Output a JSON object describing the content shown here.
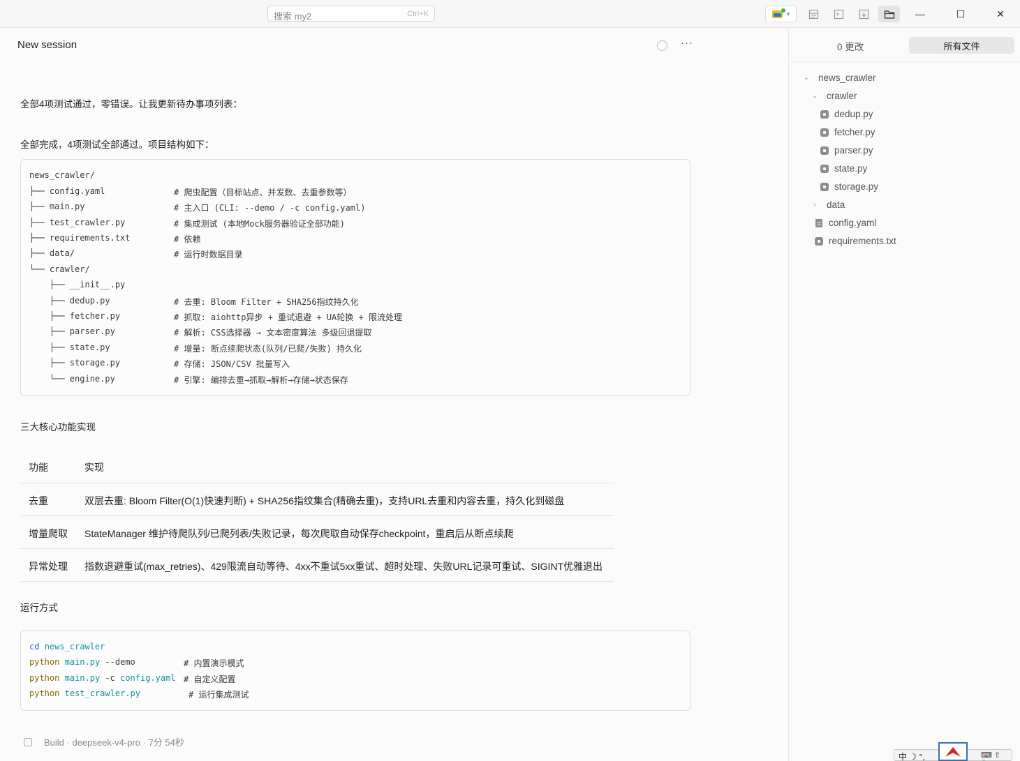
{
  "titlebar": {
    "search_placeholder": "搜索 my2",
    "search_shortcut": "Ctrl+K",
    "folder_dropdown": "▾",
    "icons": [
      "folder-icon",
      "layout-icon",
      "terminal-icon",
      "download-icon",
      "file-tree-icon"
    ],
    "window_controls": {
      "minimize": "—",
      "maximize": "☐",
      "close": "✕"
    }
  },
  "session": {
    "title": "New session",
    "more": "···"
  },
  "messages": {
    "m1": "全部4项测试通过，零错误。让我更新待办事项列表：",
    "m2": "全部完成，4项测试全部通过。项目结构如下：",
    "m3": "三大核心功能实现",
    "m4": "运行方式"
  },
  "tree_block": [
    {
      "path": "news_crawler/",
      "comment": ""
    },
    {
      "path": "├── config.yaml",
      "comment": "# 爬虫配置（目标站点、并发数、去重参数等）"
    },
    {
      "path": "├── main.py",
      "comment": "# 主入口 (CLI: --demo / -c config.yaml)"
    },
    {
      "path": "├── test_crawler.py",
      "comment": "# 集成测试 (本地Mock服务器验证全部功能)"
    },
    {
      "path": "├── requirements.txt",
      "comment": "# 依赖"
    },
    {
      "path": "├── data/",
      "comment": "# 运行时数据目录"
    },
    {
      "path": "└── crawler/",
      "comment": ""
    },
    {
      "path": "    ├── __init__.py",
      "comment": ""
    },
    {
      "path": "    ├── dedup.py",
      "comment": "# 去重: Bloom Filter + SHA256指纹持久化"
    },
    {
      "path": "    ├── fetcher.py",
      "comment": "# 抓取: aiohttp异步 + 重试退避 + UA轮换 + 限流处理"
    },
    {
      "path": "    ├── parser.py",
      "comment": "# 解析: CSS选择器 → 文本密度算法 多级回退提取"
    },
    {
      "path": "    ├── state.py",
      "comment": "# 增量: 断点续爬状态(队列/已爬/失败) 持久化"
    },
    {
      "path": "    ├── storage.py",
      "comment": "# 存储: JSON/CSV 批量写入"
    },
    {
      "path": "    └── engine.py",
      "comment": "# 引擎: 编排去重→抓取→解析→存储→状态保存"
    }
  ],
  "table": {
    "headers": [
      "功能",
      "实现"
    ],
    "rows": [
      [
        "去重",
        "双层去重: Bloom Filter(O(1)快速判断) + SHA256指纹集合(精确去重)，支持URL去重和内容去重，持久化到磁盘"
      ],
      [
        "增量爬取",
        "StateManager 维护待爬队列/已爬列表/失败记录，每次爬取自动保存checkpoint，重启后从断点续爬"
      ],
      [
        "异常处理",
        "指数退避重试(max_retries)、429限流自动等待、4xx不重试5xx重试、超时处理、失败URL记录可重试、SIGINT优雅退出"
      ]
    ]
  },
  "run_block": {
    "l1_cmd": "cd",
    "l1_arg": "news_crawler",
    "l2_cmd": "python",
    "l2_file": "main.py",
    "l2_flag": "--demo",
    "l2_comment": "# 内置演示模式",
    "l3_cmd": "python",
    "l3_file": "main.py",
    "l3_flag": "-c",
    "l3_arg": "config.yaml",
    "l3_comment": "# 自定义配置",
    "l4_cmd": "python",
    "l4_file": "test_crawler.py",
    "l4_comment": "# 运行集成测试"
  },
  "footer": "Build · deepseek-v4-pro · 7分 54秒",
  "right_panel": {
    "changes": "0 更改",
    "all_files": "所有文件",
    "tree": {
      "root": "news_crawler",
      "crawler": "crawler",
      "files_py": [
        "dedup.py",
        "fetcher.py",
        "parser.py",
        "state.py",
        "storage.py"
      ],
      "data": "data",
      "config": "config.yaml",
      "requirements": "requirements.txt"
    }
  },
  "ime": {
    "lang": "中 ☽ °,",
    "tools": "⌨ ⇧ 🔧"
  },
  "colors": {
    "accent_teal": "#15919b",
    "accent_olive": "#8a6d00",
    "folder_yellow": "#f2b824",
    "status_green": "#2db84a"
  }
}
